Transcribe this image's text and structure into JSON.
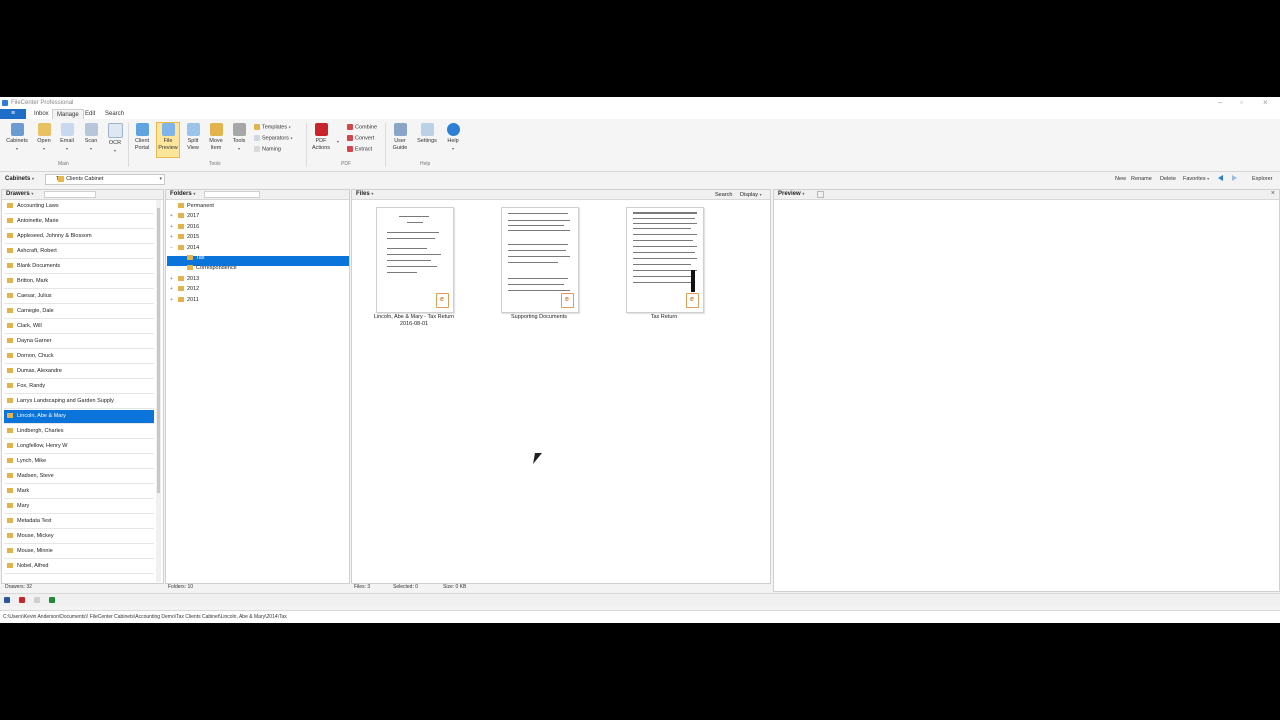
{
  "window": {
    "title": "FileCenter Professional"
  },
  "menu": {
    "tabs": [
      "Inbox",
      "Manage",
      "Edit",
      "Search"
    ],
    "active": "Manage"
  },
  "ribbon": {
    "main": {
      "label": "Main",
      "buttons": [
        "Cabinets",
        "Open",
        "Email",
        "Scan",
        "OCR"
      ]
    },
    "tools": {
      "label": "Tools",
      "client_portal": [
        "Client",
        "Portal"
      ],
      "file_preview": [
        "File",
        "Preview"
      ],
      "split_view": [
        "Split",
        "View"
      ],
      "move_item": [
        "Move",
        "Item"
      ],
      "tools_btn": "Tools",
      "templates": "Templates",
      "separators": "Separators",
      "naming": "Naming"
    },
    "pdf": {
      "label": "PDF",
      "pdf_actions": [
        "PDF",
        "Actions"
      ],
      "combine": "Combine",
      "convert": "Convert",
      "extract": "Extract"
    },
    "help": {
      "label": "Help",
      "user_guide": [
        "User",
        "Guide"
      ],
      "settings": "Settings",
      "help_btn": "Help"
    }
  },
  "cabinets": {
    "label": "Cabinets",
    "selected": "Tax Clients Cabinet"
  },
  "toplinks": {
    "new": "New",
    "rename": "Rename",
    "delete": "Delete",
    "favorites": "Favorites",
    "explorer": "Explorer"
  },
  "drawers": {
    "title": "Drawers",
    "items": [
      "Accounting Laws",
      "Antoinette, Marie",
      "Appleseed, Johnny & Blossom",
      "Ashcraft, Robert",
      "Blank Documents",
      "Britton, Mark",
      "Caesar, Julius",
      "Carnegie, Dale",
      "Clark, Will",
      "Dayna Garner",
      "Dornon, Chuck",
      "Dumas, Alexandre",
      "Fox, Randy",
      "Larrys Landscaping and Garden Supply",
      "Lincoln, Abe & Mary",
      "Lindbergh, Charles",
      "Longfellow, Henry W",
      "Lynch, Mike",
      "Madsen, Steve",
      "Mark",
      "Mary",
      "Metadata Test",
      "Mouse, Mickey",
      "Mouse, Minnie",
      "Nobel, Alfred"
    ],
    "selected_index": 14,
    "status": "Drawers: 32"
  },
  "folders": {
    "title": "Folders",
    "items": [
      {
        "label": "Permanent",
        "level": 0,
        "expand": ""
      },
      {
        "label": "2017",
        "level": 0,
        "expand": "+"
      },
      {
        "label": "2016",
        "level": 0,
        "expand": "+"
      },
      {
        "label": "2015",
        "level": 0,
        "expand": "+"
      },
      {
        "label": "2014",
        "level": 0,
        "expand": "−"
      },
      {
        "label": "Tax",
        "level": 1,
        "expand": ""
      },
      {
        "label": "Correspondence",
        "level": 1,
        "expand": ""
      },
      {
        "label": "2013",
        "level": 0,
        "expand": "+"
      },
      {
        "label": "2012",
        "level": 0,
        "expand": "+"
      },
      {
        "label": "2011",
        "level": 0,
        "expand": "+"
      }
    ],
    "selected_index": 5,
    "status": "Folders: 10"
  },
  "files": {
    "title": "Files",
    "search": "Search",
    "display": "Display",
    "items": [
      {
        "caption": "Lincoln, Abe & Mary - Tax Return 2016-08-01"
      },
      {
        "caption": "Supporting Documents"
      },
      {
        "caption": "Tax Return"
      }
    ],
    "status": {
      "files": "Files: 3",
      "selected": "Selected: 0",
      "size": "Size: 0 KB"
    }
  },
  "preview": {
    "title": "Preview"
  },
  "path": "C:\\Users\\Kevin Anderson\\Documents\\! FileCenter Cabinets\\Accounting Demo\\Tax Clients Cabinet\\Lincoln, Abe & Mary\\2014\\Tax",
  "colors": {
    "selection": "#0a74da",
    "folder": "#e3b34c",
    "accent": "#2b7fd6"
  }
}
